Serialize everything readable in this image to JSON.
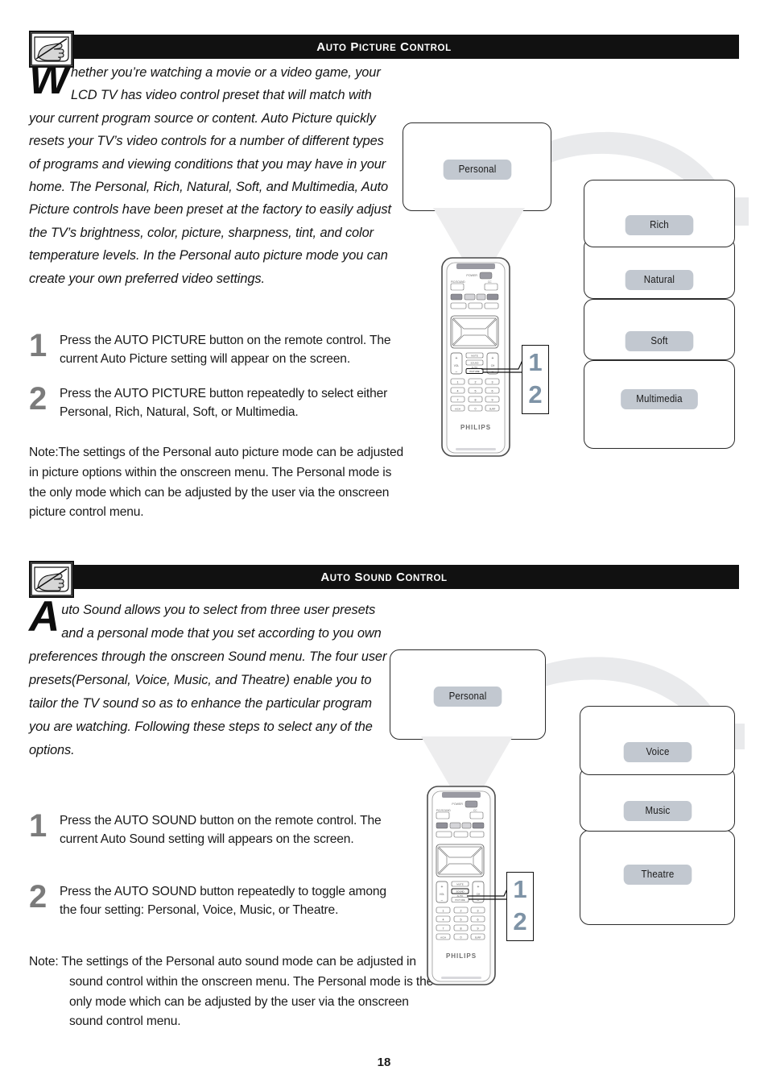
{
  "page": {
    "number": "18"
  },
  "sections": [
    {
      "id": "auto-picture",
      "icon": "hand-pointing-tv-icon",
      "title_parts": {
        "a": "A",
        "uto": "UTO",
        "p": "P",
        "icture": "ICTURE",
        "c": "C",
        "ontrol": "ONTROL"
      },
      "title_plain": "Auto Picture Control",
      "dropcap": "W",
      "intro": "hether you’re watching a movie or a video game, your LCD TV has video control preset that will match with your current program source or content. Auto Picture quickly resets your TV’s video controls for a number of different types of programs and viewing conditions that you may have in your home. The Personal, Rich, Natural, Soft, and Multimedia, Auto Picture controls have been preset at the factory to easily adjust the TV’s brightness, color, picture, sharpness, tint, and color temperature levels. In the Personal auto picture mode you can create your own preferred video settings.",
      "steps": [
        {
          "num": "1",
          "text": "Press the AUTO PICTURE button on the remote control. The current Auto Picture setting will appear on the screen."
        },
        {
          "num": "2",
          "text": "Press the AUTO PICTURE button repeatedly to select either Personal, Rich, Natural, Soft, or Multimedia."
        }
      ],
      "note": "Note:The settings of the Personal auto picture mode can be adjusted in picture options within the onscreen menu. The Personal mode is the only mode which can be adjusted by the user via the onscreen picture control menu.",
      "diagram": {
        "current_screen_label": "Personal",
        "option_screens": [
          "Rich",
          "Natural",
          "Soft",
          "Multimedia"
        ],
        "callout_numbers": [
          "1",
          "2"
        ],
        "remote_brand": "PHILIPS"
      }
    },
    {
      "id": "auto-sound",
      "icon": "hand-pointing-tv-icon",
      "title_parts": {
        "a": "A",
        "uto": "UTO",
        "p": "S",
        "icture": "OUND",
        "c": "C",
        "ontrol": "ONTROL"
      },
      "title_plain": "Auto Sound Control",
      "dropcap": "A",
      "intro": "uto Sound allows you to select from three user presets and a personal mode that you set according to you own preferences through the onscreen Sound menu. The four user presets(Personal, Voice, Music, and Theatre) enable you to tailor the TV sound so as to enhance the particular program you are watching. Following these steps to select any of the options.",
      "steps": [
        {
          "num": "1",
          "text": "Press the AUTO SOUND button on the remote control. The current Auto Sound setting will appears on the screen."
        },
        {
          "num": "2",
          "text": "Press the AUTO SOUND button repeatedly to toggle among the four setting: Personal, Voice, Music, or Theatre."
        }
      ],
      "note": "Note: The settings of the Personal auto sound mode can be adjusted in sound control within the onscreen menu. The Personal  mode is the only mode which can be adjusted by the user via the onscreen sound control menu.",
      "diagram": {
        "current_screen_label": "Personal",
        "option_screens": [
          "Voice",
          "Music",
          "Theatre"
        ],
        "callout_numbers": [
          "1",
          "2"
        ],
        "remote_brand": "PHILIPS"
      }
    }
  ],
  "colors": {
    "header_bar": "#111111",
    "pill": "#c2c8d0",
    "callout_number": "#7e93a6",
    "step_number": "#7b7b7b",
    "swoosh": "#e9eaec"
  }
}
